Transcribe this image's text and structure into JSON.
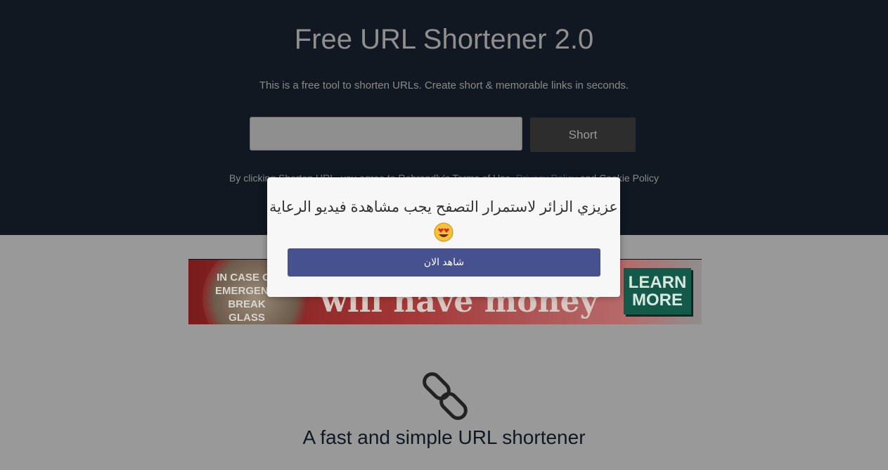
{
  "hero": {
    "title": "Free URL Shortener 2.0",
    "subtitle": "This is a free tool to shorten URLs. Create short & memorable links in seconds.",
    "url_input": {
      "value": "",
      "placeholder": ""
    },
    "short_label": "Short",
    "terms": {
      "prefix": "By clicking Shorten URL, you agree to Rebrandly's Terms of Use, ",
      "privacy_link": "Privacy Policy",
      "suffix": " and Cookie Policy"
    }
  },
  "ad": {
    "case_text": "IN CASE OF EMERGENCY BREAK GLASS",
    "headline": "will have money",
    "cta": "LEARN MORE",
    "cta_color": "#145a4a"
  },
  "feature": {
    "icon": "chain-link-icon",
    "tagline": "A fast and simple URL shortener"
  },
  "modal": {
    "message": "عزيزي الزائر لاستمرار التصفح يجب مشاهدة فيديو الرعاية",
    "emoji": "heart-eyes-emoji",
    "button_label": "شاهد الان",
    "button_color": "#465290"
  }
}
